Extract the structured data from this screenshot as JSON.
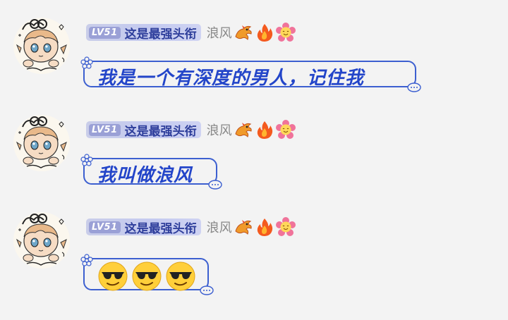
{
  "messages": [
    {
      "sender": {
        "level": "LV51",
        "title": "这是最强头衔",
        "nickname": "浪风",
        "badges": [
          "dragon-icon",
          "fire-icon",
          "flower-icon"
        ]
      },
      "text": "我是一个有深度的男人，记住我"
    },
    {
      "sender": {
        "level": "LV51",
        "title": "这是最强头衔",
        "nickname": "浪风",
        "badges": [
          "dragon-icon",
          "fire-icon",
          "flower-icon"
        ]
      },
      "text": "我叫做浪风"
    },
    {
      "sender": {
        "level": "LV51",
        "title": "这是最强头衔",
        "nickname": "浪风",
        "badges": [
          "dragon-icon",
          "fire-icon",
          "flower-icon"
        ]
      },
      "emojis": [
        "sunglasses-emoji",
        "sunglasses-emoji",
        "sunglasses-emoji"
      ]
    }
  ],
  "colors": {
    "bubble_border": "#3c5fd0",
    "bubble_text": "#2345c9",
    "title_text": "#2f3f9c",
    "nickname": "#888888",
    "background": "#f3f3f3"
  }
}
